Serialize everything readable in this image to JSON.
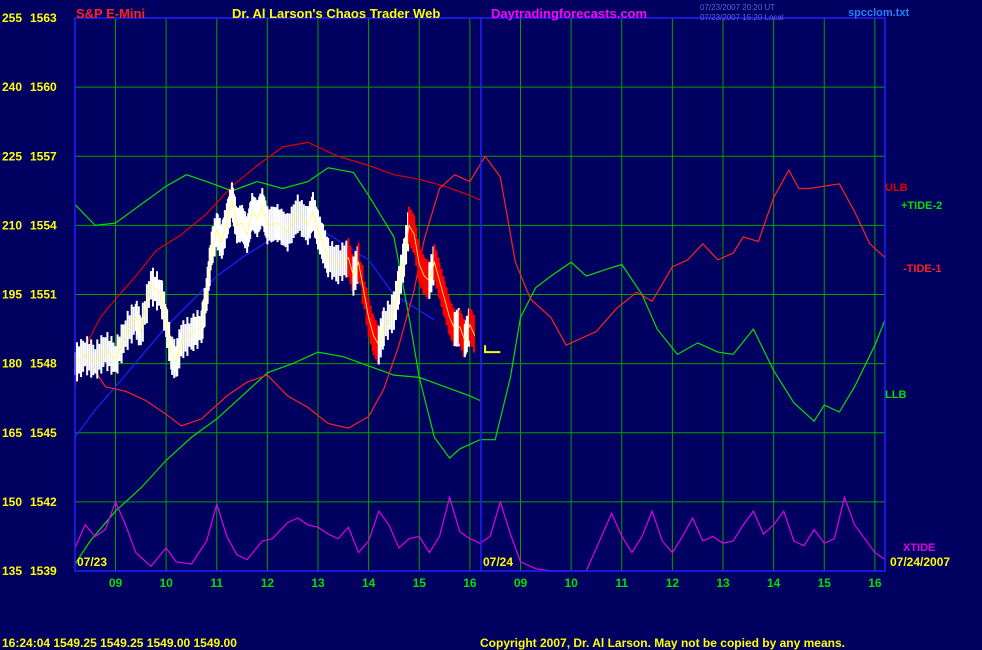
{
  "header": {
    "symbol": "S&P E-Mini",
    "title": "Dr. Al Larson's Chaos Trader Web",
    "site": "Daytradingforecasts.com",
    "time_ut": "07/23/2007 20:20 UT",
    "time_local": "07/23/2007 15:20 Local",
    "file": "spcclom.txt"
  },
  "footer": {
    "quote": "16:24:04  1549.25  1549.25  1549.00  1549.00",
    "copyright": "Copyright 2007, Dr. Al Larson. May not be copied by any means."
  },
  "chart_data": {
    "type": "line",
    "y_labels": [
      {
        "left": "255",
        "right": "1563"
      },
      {
        "left": "240",
        "right": "1560"
      },
      {
        "left": "225",
        "right": "1557"
      },
      {
        "left": "210",
        "right": "1554"
      },
      {
        "left": "195",
        "right": "1551"
      },
      {
        "left": "180",
        "right": "1548"
      },
      {
        "left": "165",
        "right": "1545"
      },
      {
        "left": "150",
        "right": "1542"
      },
      {
        "left": "135",
        "right": "1539"
      }
    ],
    "ylim": [
      1539,
      1563
    ],
    "x_ticks": [
      "09",
      "10",
      "11",
      "12",
      "13",
      "14",
      "15",
      "16",
      "09",
      "10",
      "11",
      "12",
      "13",
      "14",
      "15",
      "16"
    ],
    "xlim": [
      8.2,
      24.2
    ],
    "date_labels": [
      "07/23",
      "07/24",
      "07/24/2007"
    ],
    "series_labels": {
      "ulb": "ULB",
      "tide2": "+TIDE-2",
      "tide1": "-TIDE-1",
      "llb": "LLB",
      "xtide": "XTIDE"
    },
    "colors": {
      "background": "#000060",
      "grid": "#00A000",
      "price": "#FFFFFF",
      "price_down": "#FF0000",
      "ulb": "#E00000",
      "llb": "#00E000",
      "tide2": "#00E000",
      "tide1": "#FF2020",
      "average": "#2020FF",
      "xtide": "#E000E0"
    },
    "series": {
      "ulb": [
        [
          8.2,
          1547.0
        ],
        [
          8.4,
          1548.7
        ],
        [
          8.7,
          1550.0
        ],
        [
          9.0,
          1550.8
        ],
        [
          9.4,
          1551.8
        ],
        [
          9.8,
          1552.9
        ],
        [
          10.3,
          1553.6
        ],
        [
          10.8,
          1554.5
        ],
        [
          11.3,
          1555.7
        ],
        [
          11.8,
          1556.6
        ],
        [
          12.3,
          1557.4
        ],
        [
          12.8,
          1557.6
        ],
        [
          13.4,
          1557.0
        ],
        [
          14.0,
          1556.6
        ],
        [
          14.5,
          1556.2
        ],
        [
          15.0,
          1556.0
        ],
        [
          15.5,
          1555.7
        ],
        [
          16.0,
          1555.3
        ],
        [
          16.2,
          1555.1
        ]
      ],
      "llb": [
        [
          8.2,
          1539.3
        ],
        [
          8.5,
          1540.3
        ],
        [
          9.0,
          1541.6
        ],
        [
          9.5,
          1542.6
        ],
        [
          10.0,
          1543.8
        ],
        [
          10.5,
          1544.8
        ],
        [
          11.0,
          1545.6
        ],
        [
          11.5,
          1546.6
        ],
        [
          12.0,
          1547.6
        ],
        [
          12.5,
          1548.0
        ],
        [
          13.0,
          1548.5
        ],
        [
          13.5,
          1548.3
        ],
        [
          14.0,
          1547.9
        ],
        [
          14.5,
          1547.5
        ],
        [
          15.0,
          1547.4
        ],
        [
          15.5,
          1547.0
        ],
        [
          16.0,
          1546.6
        ],
        [
          16.2,
          1546.4
        ]
      ],
      "average": [
        [
          8.2,
          1544.8
        ],
        [
          8.6,
          1546.0
        ],
        [
          9.0,
          1547.0
        ],
        [
          9.5,
          1548.3
        ],
        [
          10.0,
          1549.6
        ],
        [
          10.5,
          1550.7
        ],
        [
          11.0,
          1551.8
        ],
        [
          11.5,
          1552.6
        ],
        [
          12.0,
          1553.3
        ],
        [
          12.5,
          1553.9
        ],
        [
          13.0,
          1553.9
        ],
        [
          13.5,
          1553.2
        ],
        [
          14.0,
          1552.5
        ],
        [
          14.5,
          1551.0
        ],
        [
          15.0,
          1550.3
        ],
        [
          15.3,
          1549.9
        ]
      ],
      "tide2": [
        [
          8.2,
          1554.9
        ],
        [
          8.6,
          1554.0
        ],
        [
          9.0,
          1554.1
        ],
        [
          9.5,
          1554.9
        ],
        [
          10.0,
          1555.7
        ],
        [
          10.4,
          1556.2
        ],
        [
          10.8,
          1555.9
        ],
        [
          11.3,
          1555.5
        ],
        [
          11.8,
          1555.9
        ],
        [
          12.3,
          1555.6
        ],
        [
          12.8,
          1555.9
        ],
        [
          13.2,
          1556.5
        ],
        [
          13.7,
          1556.3
        ],
        [
          14.0,
          1555.3
        ],
        [
          14.5,
          1553.5
        ],
        [
          14.8,
          1550.0
        ],
        [
          15.0,
          1547.4
        ],
        [
          15.3,
          1544.8
        ],
        [
          15.6,
          1543.9
        ],
        [
          15.8,
          1544.3
        ],
        [
          16.2,
          1544.7
        ],
        [
          16.5,
          1544.7
        ],
        [
          16.8,
          1547.4
        ],
        [
          17.0,
          1550.0
        ],
        [
          17.3,
          1551.3
        ],
        [
          17.6,
          1551.8
        ],
        [
          18.0,
          1552.4
        ],
        [
          18.3,
          1551.8
        ],
        [
          18.7,
          1552.1
        ],
        [
          19.0,
          1552.3
        ],
        [
          19.4,
          1551.0
        ],
        [
          19.7,
          1549.5
        ],
        [
          20.1,
          1548.4
        ],
        [
          20.5,
          1548.9
        ],
        [
          20.9,
          1548.5
        ],
        [
          21.2,
          1548.4
        ],
        [
          21.6,
          1549.5
        ],
        [
          22.0,
          1547.7
        ],
        [
          22.4,
          1546.3
        ],
        [
          22.8,
          1545.5
        ],
        [
          23.0,
          1546.2
        ],
        [
          23.3,
          1545.9
        ],
        [
          23.6,
          1547.0
        ],
        [
          24.0,
          1548.8
        ],
        [
          24.2,
          1549.9
        ]
      ],
      "tide1": [
        [
          8.2,
          1548.5
        ],
        [
          8.5,
          1548.0
        ],
        [
          8.8,
          1547.0
        ],
        [
          9.2,
          1546.8
        ],
        [
          9.6,
          1546.4
        ],
        [
          10.0,
          1545.8
        ],
        [
          10.3,
          1545.3
        ],
        [
          10.7,
          1545.6
        ],
        [
          11.2,
          1546.6
        ],
        [
          11.6,
          1547.2
        ],
        [
          12.0,
          1547.5
        ],
        [
          12.4,
          1546.6
        ],
        [
          12.8,
          1546.1
        ],
        [
          13.2,
          1545.4
        ],
        [
          13.6,
          1545.2
        ],
        [
          14.0,
          1545.7
        ],
        [
          14.3,
          1546.9
        ],
        [
          14.6,
          1548.8
        ],
        [
          14.9,
          1551.2
        ],
        [
          15.1,
          1553.4
        ],
        [
          15.4,
          1555.6
        ],
        [
          15.7,
          1556.2
        ],
        [
          16.0,
          1555.9
        ],
        [
          16.3,
          1557.0
        ],
        [
          16.6,
          1556.1
        ],
        [
          16.9,
          1552.4
        ],
        [
          17.2,
          1550.8
        ],
        [
          17.6,
          1550.0
        ],
        [
          17.9,
          1548.8
        ],
        [
          18.2,
          1549.1
        ],
        [
          18.5,
          1549.4
        ],
        [
          18.9,
          1550.4
        ],
        [
          19.3,
          1551.1
        ],
        [
          19.6,
          1550.7
        ],
        [
          20.0,
          1552.2
        ],
        [
          20.3,
          1552.5
        ],
        [
          20.6,
          1553.2
        ],
        [
          20.9,
          1552.5
        ],
        [
          21.2,
          1552.8
        ],
        [
          21.4,
          1553.5
        ],
        [
          21.7,
          1553.3
        ],
        [
          22.0,
          1555.2
        ],
        [
          22.3,
          1556.4
        ],
        [
          22.5,
          1555.6
        ],
        [
          22.7,
          1555.6
        ],
        [
          23.0,
          1555.7
        ],
        [
          23.3,
          1555.8
        ],
        [
          23.6,
          1554.6
        ],
        [
          23.9,
          1553.2
        ],
        [
          24.2,
          1552.6
        ]
      ],
      "xtide": [
        [
          8.2,
          1540.0
        ],
        [
          8.4,
          1541.0
        ],
        [
          8.6,
          1540.5
        ],
        [
          8.8,
          1540.8
        ],
        [
          9.0,
          1542.0
        ],
        [
          9.2,
          1541.0
        ],
        [
          9.4,
          1539.8
        ],
        [
          9.7,
          1539.2
        ],
        [
          10.0,
          1540.0
        ],
        [
          10.2,
          1539.4
        ],
        [
          10.5,
          1539.3
        ],
        [
          10.8,
          1540.3
        ],
        [
          11.0,
          1541.9
        ],
        [
          11.2,
          1540.5
        ],
        [
          11.4,
          1539.7
        ],
        [
          11.6,
          1539.5
        ],
        [
          11.9,
          1540.3
        ],
        [
          12.1,
          1540.4
        ],
        [
          12.4,
          1541.1
        ],
        [
          12.6,
          1541.3
        ],
        [
          12.8,
          1541.0
        ],
        [
          13.0,
          1540.9
        ],
        [
          13.2,
          1540.6
        ],
        [
          13.4,
          1540.4
        ],
        [
          13.6,
          1540.9
        ],
        [
          13.8,
          1539.8
        ],
        [
          14.0,
          1540.3
        ],
        [
          14.2,
          1541.6
        ],
        [
          14.4,
          1541.0
        ],
        [
          14.6,
          1540.0
        ],
        [
          14.8,
          1540.4
        ],
        [
          15.0,
          1540.5
        ],
        [
          15.2,
          1539.8
        ],
        [
          15.4,
          1540.5
        ],
        [
          15.6,
          1542.2
        ],
        [
          15.8,
          1540.7
        ],
        [
          16.0,
          1540.4
        ],
        [
          16.2,
          1540.2
        ],
        [
          16.4,
          1540.5
        ],
        [
          16.6,
          1542.0
        ],
        [
          16.8,
          1540.6
        ],
        [
          17.0,
          1539.4
        ],
        [
          17.3,
          1539.1
        ],
        [
          17.6,
          1539.0
        ],
        [
          18.0,
          1539.0
        ],
        [
          18.3,
          1539.0
        ],
        [
          18.6,
          1540.5
        ],
        [
          18.8,
          1541.5
        ],
        [
          19.0,
          1540.5
        ],
        [
          19.2,
          1539.8
        ],
        [
          19.4,
          1540.5
        ],
        [
          19.6,
          1541.6
        ],
        [
          19.8,
          1540.3
        ],
        [
          20.0,
          1539.8
        ],
        [
          20.2,
          1540.5
        ],
        [
          20.4,
          1541.3
        ],
        [
          20.6,
          1540.3
        ],
        [
          20.8,
          1540.5
        ],
        [
          21.0,
          1540.2
        ],
        [
          21.2,
          1540.3
        ],
        [
          21.4,
          1541.0
        ],
        [
          21.6,
          1541.6
        ],
        [
          21.8,
          1540.6
        ],
        [
          22.0,
          1541.0
        ],
        [
          22.2,
          1541.6
        ],
        [
          22.4,
          1540.3
        ],
        [
          22.6,
          1540.1
        ],
        [
          22.8,
          1540.8
        ],
        [
          23.0,
          1540.2
        ],
        [
          23.2,
          1540.4
        ],
        [
          23.4,
          1542.2
        ],
        [
          23.6,
          1541.0
        ],
        [
          23.8,
          1540.4
        ],
        [
          24.0,
          1539.8
        ],
        [
          24.2,
          1539.5
        ]
      ],
      "price": [
        [
          8.2,
          1548.0
        ],
        [
          8.4,
          1548.4
        ],
        [
          8.6,
          1548.1
        ],
        [
          8.8,
          1548.6
        ],
        [
          9.0,
          1548.2
        ],
        [
          9.2,
          1549.3
        ],
        [
          9.4,
          1550.0
        ],
        [
          9.5,
          1549.4
        ],
        [
          9.7,
          1551.4
        ],
        [
          9.9,
          1551.0
        ],
        [
          10.0,
          1549.8
        ],
        [
          10.1,
          1548.4
        ],
        [
          10.2,
          1548.1
        ],
        [
          10.3,
          1549.0
        ],
        [
          10.5,
          1549.3
        ],
        [
          10.7,
          1549.6
        ],
        [
          10.8,
          1551.0
        ],
        [
          10.9,
          1553.0
        ],
        [
          11.0,
          1553.8
        ],
        [
          11.1,
          1553.3
        ],
        [
          11.2,
          1554.2
        ],
        [
          11.3,
          1555.1
        ],
        [
          11.4,
          1554.0
        ],
        [
          11.5,
          1554.1
        ],
        [
          11.6,
          1553.6
        ],
        [
          11.7,
          1554.6
        ],
        [
          11.8,
          1554.3
        ],
        [
          11.9,
          1554.8
        ],
        [
          12.0,
          1554.0
        ],
        [
          12.2,
          1554.1
        ],
        [
          12.4,
          1553.7
        ],
        [
          12.6,
          1554.5
        ],
        [
          12.8,
          1554.0
        ],
        [
          12.9,
          1554.6
        ],
        [
          13.0,
          1553.8
        ],
        [
          13.1,
          1553.2
        ],
        [
          13.2,
          1552.6
        ],
        [
          13.4,
          1552.3
        ],
        [
          13.6,
          1552.6
        ],
        [
          13.7,
          1551.8
        ],
        [
          13.8,
          1552.4
        ],
        [
          14.0,
          1550.0
        ],
        [
          14.1,
          1549.2
        ],
        [
          14.2,
          1548.8
        ],
        [
          14.3,
          1549.6
        ],
        [
          14.5,
          1550.3
        ],
        [
          14.6,
          1551.4
        ],
        [
          14.7,
          1552.6
        ],
        [
          14.8,
          1554.0
        ],
        [
          14.9,
          1553.6
        ],
        [
          15.0,
          1552.3
        ],
        [
          15.1,
          1551.8
        ],
        [
          15.2,
          1551.6
        ],
        [
          15.3,
          1552.4
        ],
        [
          15.4,
          1551.6
        ],
        [
          15.5,
          1550.8
        ],
        [
          15.6,
          1550.0
        ],
        [
          15.7,
          1549.5
        ],
        [
          15.8,
          1549.6
        ],
        [
          15.9,
          1549.0
        ],
        [
          16.0,
          1549.7
        ],
        [
          16.1,
          1549.2
        ]
      ],
      "last_marker": [
        [
          16.3,
          1548.8
        ],
        [
          16.3,
          1548.5
        ],
        [
          16.6,
          1548.5
        ]
      ]
    }
  }
}
